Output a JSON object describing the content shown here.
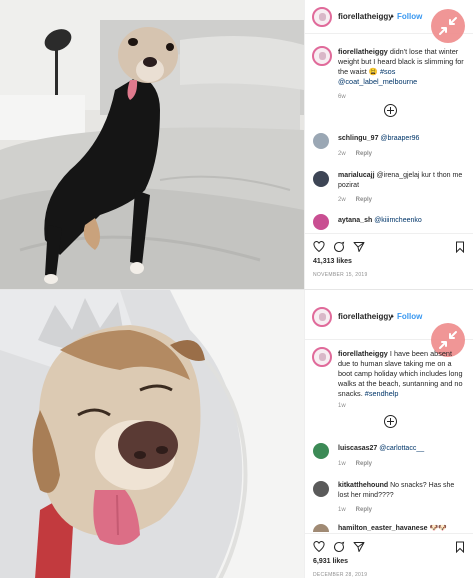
{
  "post1": {
    "username": "fiorellatheiggy",
    "follow_label": "Follow",
    "caption": {
      "user": "fiorellatheiggy",
      "text": "didn't lose that winter weight but I heard black is slimming for the waist 😩",
      "hashtag": "#sos",
      "mention": "@coat_label_melbourne"
    },
    "caption_time": "6w",
    "comments": [
      {
        "user": "schlingu_97",
        "text": "@braaper96",
        "time": "2w",
        "reply": "Reply",
        "avatar_color": "#9aa7b4"
      },
      {
        "user": "marialucajj",
        "text": "@irena_gjelaj kur t thon me pozirat",
        "time": "2w",
        "reply": "Reply",
        "avatar_color": "#3d4555"
      },
      {
        "user": "aytana_sh",
        "text": "@kiiimcheenko",
        "avatar_color": "#c94f92"
      }
    ],
    "likes": "41,313 likes",
    "date": "NOVEMBER 15, 2019"
  },
  "post2": {
    "username": "fiorellatheiggy",
    "follow_label": "Follow",
    "caption": {
      "user": "fiorellatheiggy",
      "text": "I have been absent due to human slave taking me on a boot camp holiday which includes long walks at the beach, suntanning and no snacks.",
      "hashtag": "#sendhelp"
    },
    "caption_time": "1w",
    "comments": [
      {
        "user": "luiscasas27",
        "text": "@carlottacc__",
        "time": "1w",
        "reply": "Reply",
        "avatar_color": "#3c8a56"
      },
      {
        "user": "kitkatthehound",
        "text": "No snacks? Has she lost her mind????",
        "time": "1w",
        "reply": "Reply",
        "avatar_color": "#5a5a5a"
      },
      {
        "user": "hamilton_easter_havanese",
        "text": "🐶🐶",
        "avatar_color": "#a08a74"
      }
    ],
    "likes": "6,931 likes",
    "date": "DECEMBER 28, 2019"
  }
}
